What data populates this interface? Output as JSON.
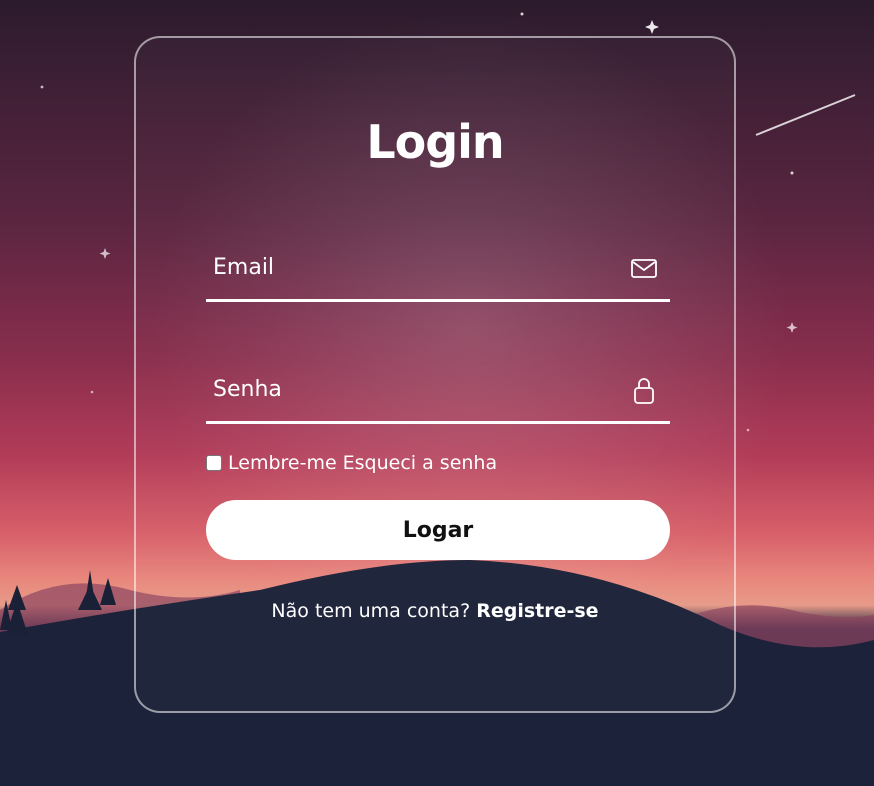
{
  "login": {
    "title": "Login",
    "email_placeholder": "Email",
    "email_icon": "envelope-icon",
    "password_placeholder": "Senha",
    "password_icon": "lock-icon",
    "remember_label": "Lembre-me",
    "remember_checked": false,
    "forgot_label": "Esqueci a senha",
    "submit_label": "Logar",
    "register_prompt": "Não tem uma conta?",
    "register_link": "Registre-se"
  },
  "colors": {
    "text": "#ffffff",
    "button_bg": "#ffffff",
    "button_text": "#111111",
    "card_border": "#ffffff"
  }
}
